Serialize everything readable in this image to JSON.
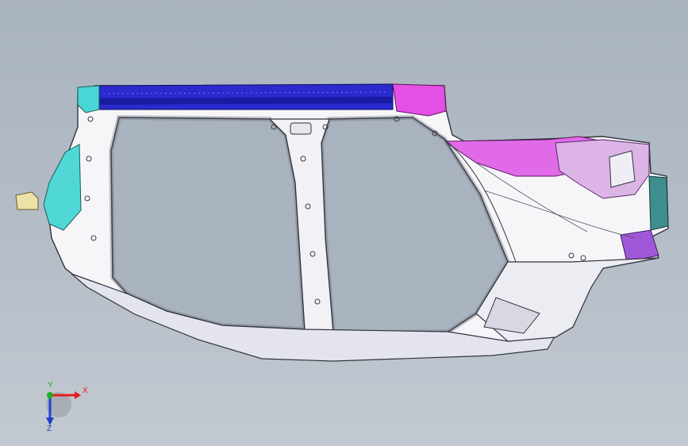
{
  "viewport": {
    "background_top": "#a9b3bf",
    "background_bottom": "#c3c9d1"
  },
  "model": {
    "part_colors": {
      "roof_rail": "#2c2cd0",
      "roof_rail_dark": "#1818a0",
      "rear_quarter_upper": "#e64fe6",
      "rear_quarter_inner": "#b85ad8",
      "front_bracket": "#47d8d6",
      "hinge_bracket": "#e6dba0",
      "body_panel": "#f7f7fa",
      "rocker": "#e8e8f2",
      "tail_panel": "#3b8c8a"
    }
  },
  "triad": {
    "x_label": "X",
    "y_label": "Y",
    "z_label": "Z",
    "x_color": "#e02020",
    "y_color": "#20b020",
    "z_color": "#2040d0"
  }
}
